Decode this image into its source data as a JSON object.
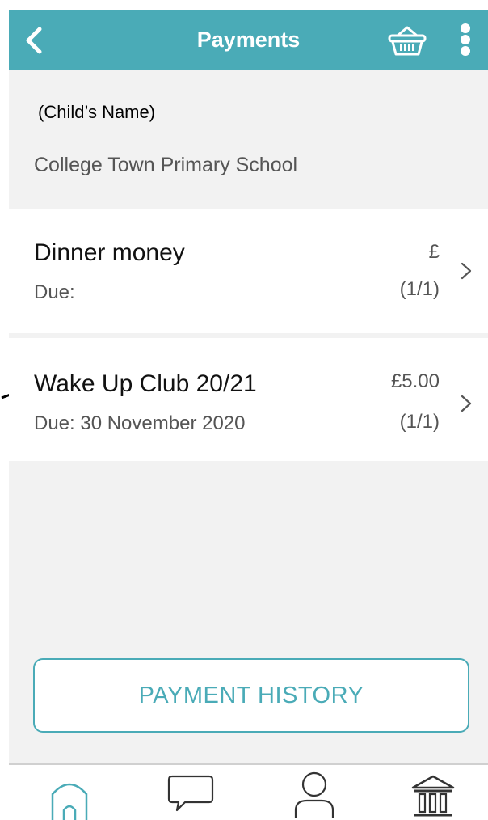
{
  "header": {
    "title": "Payments",
    "back_icon": "chevron-left-icon",
    "basket_icon": "basket-icon",
    "more_icon": "more-vertical-icon"
  },
  "child": {
    "name": "(Child’s Name)",
    "school": "College Town Primary School"
  },
  "payments": [
    {
      "title": "Dinner money",
      "due": "Due:",
      "amount": "£",
      "count": "(1/1)"
    },
    {
      "title": "Wake Up Club 20/21",
      "due": "Due: 30 November 2020",
      "amount": "£5.00",
      "count": "(1/1)"
    }
  ],
  "history_button": {
    "label": "PAYMENT HISTORY"
  },
  "tabbar": {
    "items": [
      "home-icon",
      "message-icon",
      "profile-icon",
      "bank-icon"
    ]
  },
  "colors": {
    "accent": "#4aabb7",
    "background": "#f2f2f2",
    "text_primary": "#111111",
    "text_secondary": "#555555"
  }
}
